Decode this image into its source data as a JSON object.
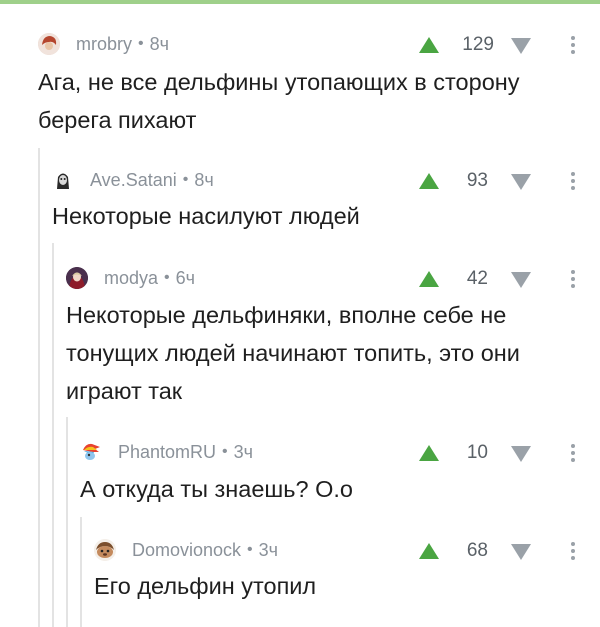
{
  "comments": [
    {
      "username": "mrobry",
      "time": "8ч",
      "score": "129",
      "text": [
        "Ага, не все дельфины утопающих в сторону",
        "берега пихают"
      ]
    },
    {
      "username": "Ave.Satani",
      "time": "8ч",
      "score": "93",
      "text": [
        "Некоторые насилуют людей"
      ]
    },
    {
      "username": "modya",
      "time": "6ч",
      "score": "42",
      "text": [
        "Некоторые дельфиняки, вполне себе не",
        "тонущих людей начинают топить, это они",
        "играют так"
      ]
    },
    {
      "username": "PhantomRU",
      "time": "3ч",
      "score": "10",
      "text": [
        "А откуда ты знаешь? О.о"
      ]
    },
    {
      "username": "Domovionock",
      "time": "3ч",
      "score": "68",
      "text": [
        "Его дельфин утопил"
      ]
    }
  ],
  "separator": "•",
  "colors": {
    "upvote": "#4aa542",
    "downvote": "#9aa1a8",
    "meta": "#8a9199",
    "thread_line": "#e3e3e3",
    "accent_bar": "#9fd08a"
  },
  "icons": [
    "upvote-arrow-icon",
    "downvote-arrow-icon",
    "more-vertical-icon",
    "avatar-icon"
  ]
}
